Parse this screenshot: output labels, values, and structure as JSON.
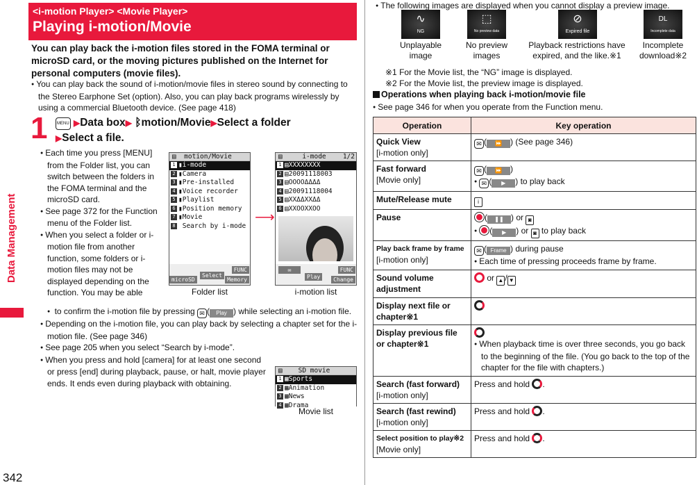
{
  "side_tab": {
    "label": "Data Management"
  },
  "page_number": "342",
  "header": {
    "subtitle": "<i-motion Player> <Movie Player>",
    "title": "Playing i-motion/Movie"
  },
  "intro": "You can play back the i-motion files stored in the FOMA terminal or microSD card, or the moving pictures published on the Internet for personal computers (movie files).",
  "intro_bullet": "You can play back the sound of i-motion/movie files in stereo sound by connecting to the Stereo Earphone Set (option). Also, you can play back programs wirelessly by using a commercial Bluetooth device. (See page 418)",
  "step": {
    "number": "1",
    "menu_key": "MENU",
    "parts": [
      "Data box",
      "motion/Movie",
      "Select a folder",
      "Select a file."
    ]
  },
  "step_bullets": [
    "Each time you press [MENU] from the Folder list, you can switch between the folders in the FOMA terminal and the microSD card.",
    "See page 372 for the Function menu of the Folder list.",
    "When you select a folder or i-motion file from another function, some folders or i-motion files may not be displayed depending on the function. You may be able"
  ],
  "wide_bullets": {
    "continuation_a": "to confirm the i-motion file by pressing",
    "play_label": "Play",
    "continuation_b": ") while selecting an i-motion file.",
    "items": [
      "Depending on the i-motion file, you can play back by selecting a chapter set for the i-motion file. (See page 346)",
      "See page 205 when you select “Search by i-mode”.",
      "When you press and hold [camera] for at least one second or press [end] during playback, pause, or halt, movie player ends. It ends even during playback with obtaining."
    ]
  },
  "screens": {
    "folder_list": {
      "title": "motion/Movie",
      "rows": [
        "i-mode",
        "Camera",
        "Pre-installed",
        "Voice recorder",
        "Playlist",
        "Position memory",
        "Movie",
        "Search by i-mode"
      ],
      "softkeys": {
        "left": "microSD",
        "center": "Select",
        "right_top": "FUNC",
        "right_bottom": "Memory"
      },
      "caption": "Folder list"
    },
    "imotion_list": {
      "title": "i-mode",
      "page": "1/2",
      "rows": [
        "XXXXXXXX",
        "20091118003",
        "OOOOΔΔΔΔ",
        "20091118004",
        "XXΔΔXXΔΔ",
        "XXOOXXOO"
      ],
      "softkeys": {
        "center": "Play",
        "right_top": "FUNC",
        "right_bottom": "Change"
      },
      "caption": "i-motion list"
    },
    "movie_list": {
      "title": "SD movie",
      "rows": [
        "Sports",
        "Animation",
        "News",
        "Drama"
      ],
      "caption": "Movie list"
    }
  },
  "preview_note": "The following images are displayed when you cannot display a preview image.",
  "preview_icons": [
    {
      "img_text": "NG",
      "label": "Unplayable image"
    },
    {
      "img_text": "No preview data",
      "label": "No preview images"
    },
    {
      "img_text": "Expired file",
      "label": "Playback restrictions have expired, and the like.※1"
    },
    {
      "img_text": "Incomplete data",
      "label": "Incomplete download※2"
    }
  ],
  "notes": [
    "※1  For the Movie list, the “NG” image is displayed.",
    "※2  For the Movie list, the preview image is displayed."
  ],
  "operations_heading": "Operations when playing back i-motion/movie file",
  "operations_bullet": "See page 346 for when you operate from the Function menu.",
  "table": {
    "headers": [
      "Operation",
      "Key operation"
    ],
    "rows": [
      {
        "op": "Quick View",
        "sub": "[i-motion only]",
        "key": ") (See page 346)"
      },
      {
        "op": "Fast forward",
        "sub": "[Movie only]",
        "key": ")",
        "key2": ") to play back"
      },
      {
        "op": "Mute/Release mute",
        "sub": "",
        "key": ""
      },
      {
        "op": "Pause",
        "sub": "",
        "key": ") or",
        "key2": ") or",
        "key2b": "to play back"
      },
      {
        "op": "Play back frame by frame",
        "sub": "[i-motion only]",
        "key": ") during pause",
        "key2": "Each time of pressing proceeds frame by frame.",
        "btn": "Frame"
      },
      {
        "op": "Sound volume adjustment",
        "sub": "",
        "key": "or"
      },
      {
        "op": "Display next file or chapter※1",
        "sub": "",
        "key": ""
      },
      {
        "op": "Display previous file or chapter※1",
        "sub": "",
        "key": "",
        "key2": "When playback time is over three seconds, you go back to the beginning of the file. (You go back to the top of the chapter for the file with chapters.)"
      },
      {
        "op": "Search (fast forward)",
        "sub": "[i-motion only]",
        "key": "Press and hold"
      },
      {
        "op": "Search (fast rewind)",
        "sub": "[i-motion only]",
        "key": "Press and hold"
      },
      {
        "op": "Select position to play※2",
        "sub": "[Movie only]",
        "key": "Press and hold"
      }
    ]
  },
  "colors": {
    "accent": "#e8193c",
    "table_header_bg": "#fbe3de"
  }
}
